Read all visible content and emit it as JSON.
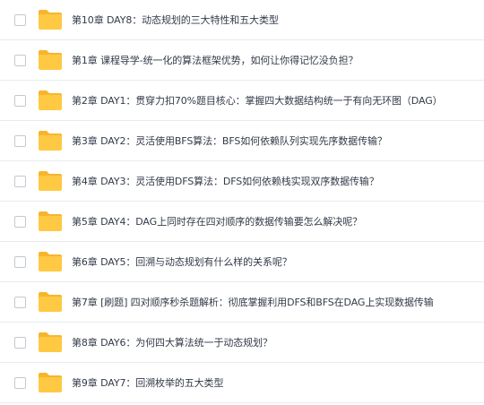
{
  "colors": {
    "folder_body": "#FFC943",
    "folder_tab": "#F7B52C",
    "text": "#333a48",
    "divider": "#e6ebf1"
  },
  "file_list": {
    "items": [
      {
        "icon": "folder-icon",
        "name": "第10章 DAY8：动态规划的三大特性和五大类型"
      },
      {
        "icon": "folder-icon",
        "name": "第1章 课程导学-统一化的算法框架优势，如何让你得记忆没负担？"
      },
      {
        "icon": "folder-icon",
        "name": "第2章 DAY1：贯穿力扣70%题目核心：掌握四大数据结构统一于有向无环图（DAG）"
      },
      {
        "icon": "folder-icon",
        "name": "第3章 DAY2：灵活使用BFS算法：BFS如何依赖队列实现先序数据传输？"
      },
      {
        "icon": "folder-icon",
        "name": "第4章 DAY3：灵活使用DFS算法：DFS如何依赖栈实现双序数据传输？"
      },
      {
        "icon": "folder-icon",
        "name": "第5章 DAY4：DAG上同时存在四对顺序的数据传输要怎么解决呢？"
      },
      {
        "icon": "folder-icon",
        "name": "第6章 DAY5：回溯与动态规划有什么样的关系呢？"
      },
      {
        "icon": "folder-icon",
        "name": "第7章 [刷题] 四对顺序秒杀题解析：彻底掌握利用DFS和BFS在DAG上实现数据传输"
      },
      {
        "icon": "folder-icon",
        "name": "第8章 DAY6：为何四大算法统一于动态规划？"
      },
      {
        "icon": "folder-icon",
        "name": "第9章 DAY7：回溯枚举的五大类型"
      }
    ]
  }
}
